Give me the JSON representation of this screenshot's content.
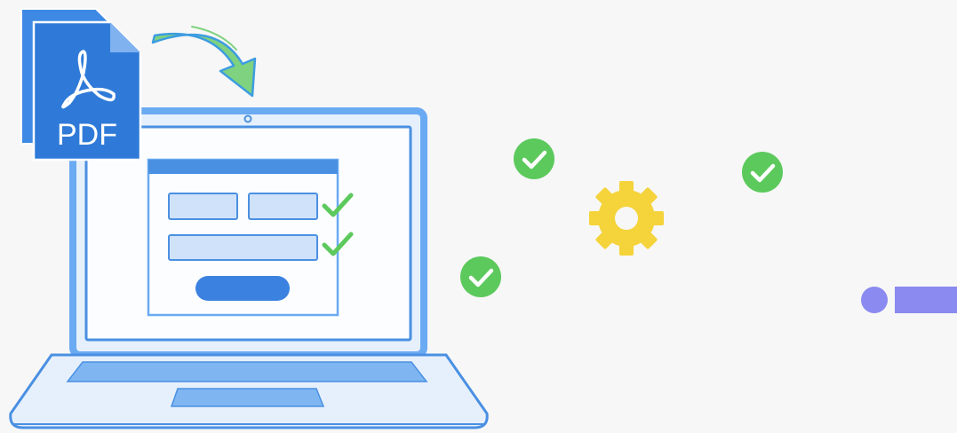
{
  "pdf_document": {
    "label": "PDF",
    "icon": "adobe-acrobat-icon"
  },
  "colors": {
    "background": "#f7f7f7",
    "laptop_fill": "#e6f0fc",
    "laptop_stroke": "#4a90e2",
    "screen_border": "#6aaaf2",
    "pdf_front": "#2f7ad8",
    "pdf_back": "#3d89e4",
    "form_field": "#cfe2fa",
    "form_button": "#3b82e0",
    "arrow_fill": "#7fd27f",
    "arrow_stroke": "#3d9de0",
    "check_badge": "#5cc95c",
    "check_mark": "#5cc95c",
    "gear": "#f5d33a",
    "indicator": "#8a8af0"
  },
  "icons": {
    "arrow": "curved-arrow-icon",
    "gear": "gear-icon",
    "check": "check-icon",
    "webcam": "webcam-icon"
  }
}
